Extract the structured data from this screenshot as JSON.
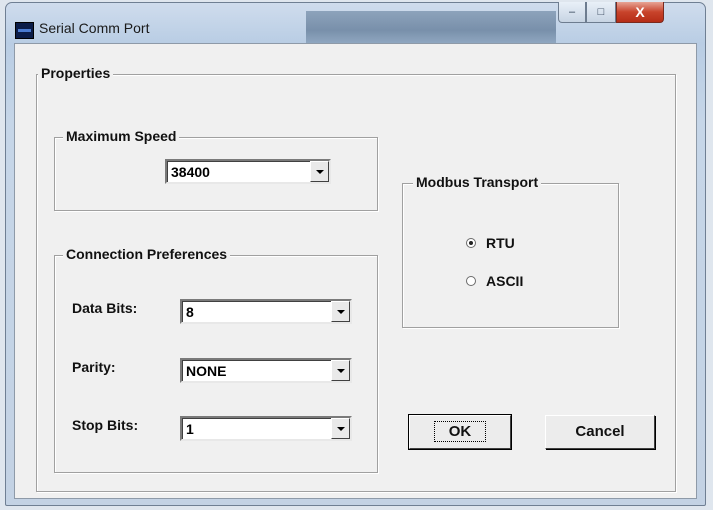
{
  "window": {
    "title": "Serial Comm Port",
    "minimize_symbol": "‒",
    "maximize_symbol": "□",
    "close_symbol": "X"
  },
  "properties": {
    "legend": "Properties",
    "max_speed": {
      "legend": "Maximum Speed",
      "value": "38400"
    },
    "connection": {
      "legend": "Connection Preferences",
      "data_bits_label": "Data Bits:",
      "data_bits_value": "8",
      "parity_label": "Parity:",
      "parity_value": "NONE",
      "stop_bits_label": "Stop Bits:",
      "stop_bits_value": "1"
    },
    "modbus": {
      "legend": "Modbus Transport",
      "options": [
        {
          "label": "RTU",
          "selected": true
        },
        {
          "label": "ASCII",
          "selected": false
        }
      ]
    }
  },
  "buttons": {
    "ok": "OK",
    "cancel": "Cancel"
  }
}
